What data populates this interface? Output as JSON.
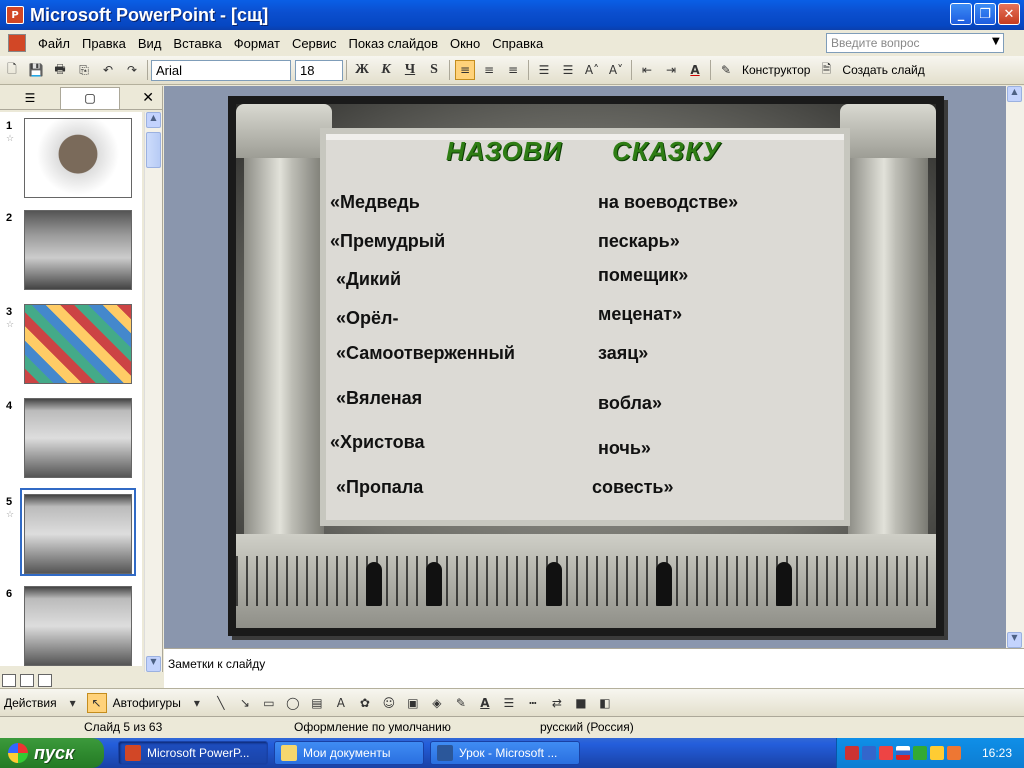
{
  "window": {
    "title": "Microsoft PowerPoint - [сщ]"
  },
  "menu": {
    "items": [
      "Файл",
      "Правка",
      "Вид",
      "Вставка",
      "Формат",
      "Сервис",
      "Показ слайдов",
      "Окно",
      "Справка"
    ],
    "help_placeholder": "Введите вопрос"
  },
  "toolbar": {
    "font_name": "Arial",
    "font_size": "18",
    "bold_label": "Ж",
    "italic_label": "К",
    "underline_label": "Ч",
    "shadow_label": "S",
    "constructor_label": "Конструктор",
    "create_slide_label": "Создать слайд"
  },
  "left_panel": {
    "slides": [
      {
        "num": "1",
        "star": "☆"
      },
      {
        "num": "2",
        "star": ""
      },
      {
        "num": "3",
        "star": "☆"
      },
      {
        "num": "4",
        "star": ""
      },
      {
        "num": "5",
        "star": "☆",
        "selected": true
      },
      {
        "num": "6",
        "star": ""
      }
    ]
  },
  "slide": {
    "title_left": "НАЗОВИ",
    "title_right": "СКАЗКУ",
    "rows": [
      {
        "left": "«Медведь",
        "right": "на воеводстве»"
      },
      {
        "left": "«Премудрый",
        "right": "пескарь»"
      },
      {
        "left": "«Дикий",
        "right": "помещик»"
      },
      {
        "left": "«Орёл-",
        "right": "меценат»"
      },
      {
        "left": "«Самоотверженный",
        "right": "заяц»"
      },
      {
        "left": "«Вяленая",
        "right": "вобла»"
      },
      {
        "left": "«Христова",
        "right": "ночь»"
      },
      {
        "left": "«Пропала",
        "right": "совесть»"
      }
    ]
  },
  "notes": {
    "placeholder": "Заметки к слайду"
  },
  "drawbar": {
    "actions_label": "Действия",
    "autoshapes_label": "Автофигуры"
  },
  "status": {
    "slide_info": "Слайд 5 из 63",
    "design": "Оформление по умолчанию",
    "language": "русский (Россия)"
  },
  "taskbar": {
    "start_label": "пуск",
    "tasks": [
      {
        "label": "Microsoft PowerP...",
        "active": true
      },
      {
        "label": "Мои документы",
        "active": false
      },
      {
        "label": "Урок - Microsoft ...",
        "active": false
      }
    ],
    "clock": "16:23"
  },
  "colors": {
    "title_green": "#2e7d14",
    "titlebar_blue": "#0b4fd0",
    "taskbar_blue": "#245edb"
  }
}
